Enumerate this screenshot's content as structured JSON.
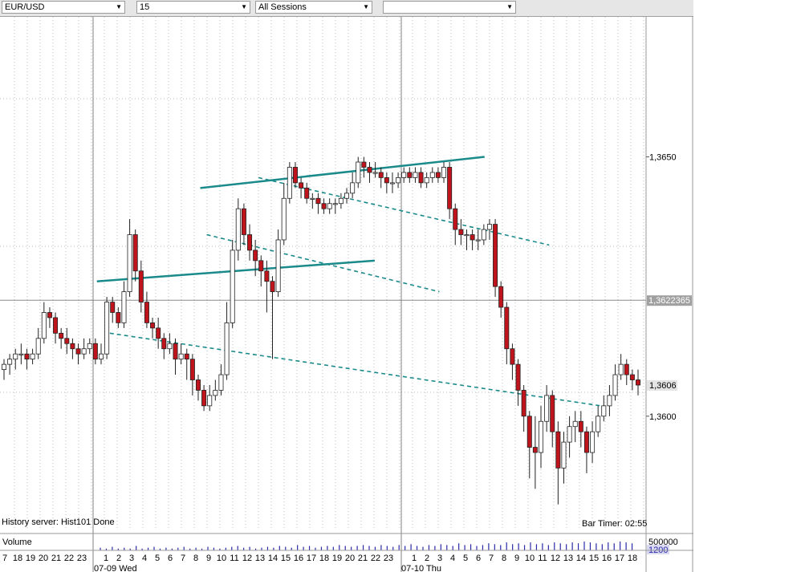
{
  "toolbar": {
    "symbol": "EUR/USD",
    "interval": "15",
    "sessions": "All Sessions",
    "extra": ""
  },
  "status": {
    "history": "History server: Hist101 Done",
    "bar_timer": "Bar Timer: 02:55"
  },
  "volume": {
    "label": "Volume",
    "scale_label": "500000",
    "value": "1200",
    "bars": [
      3,
      2,
      4,
      2,
      3,
      2,
      5,
      2,
      3,
      4,
      2,
      3,
      2,
      3,
      4,
      2,
      3,
      2,
      4,
      3,
      2,
      3,
      4,
      5,
      3,
      4,
      2,
      3,
      4,
      3,
      5,
      4,
      3,
      6,
      4,
      5,
      3,
      4,
      5,
      4,
      6,
      5,
      4,
      5,
      6,
      5,
      4,
      6,
      5,
      4,
      6,
      5,
      7,
      5,
      4,
      6,
      5,
      7,
      6,
      5,
      8,
      6,
      7,
      5,
      6,
      8,
      7,
      6,
      9,
      7,
      8,
      6,
      9,
      7,
      8,
      6,
      9,
      8,
      7,
      9,
      8,
      10,
      9,
      8,
      7,
      9,
      8,
      10,
      9,
      8
    ]
  },
  "price_axis": {
    "labels": [
      "1,3650",
      "1,3600"
    ],
    "crosshair_label": "1,3622365",
    "last_label": "1,3606"
  },
  "time_axis": {
    "hours": [
      "7",
      "18",
      "19",
      "20",
      "21",
      "22",
      "23",
      "1",
      "2",
      "3",
      "4",
      "5",
      "6",
      "7",
      "8",
      "9",
      "10",
      "11",
      "12",
      "13",
      "14",
      "15",
      "16",
      "17",
      "18",
      "19",
      "20",
      "21",
      "22",
      "23",
      "1",
      "2",
      "3",
      "4",
      "5",
      "6",
      "7",
      "8",
      "9",
      "10",
      "11",
      "12",
      "13",
      "14",
      "15",
      "16",
      "17",
      "18"
    ],
    "dates": [
      "07-09 Wed",
      "07-10 Thu"
    ]
  },
  "chart_data": {
    "type": "candlestick",
    "instrument": "EUR/USD",
    "timeframe": "15",
    "ylim": [
      1.3578,
      1.3677
    ],
    "y_ticks": [
      1.365,
      1.36
    ],
    "crosshair_price": 1.3622365,
    "last_price": 1.3606,
    "closes": [
      1.361,
      1.3611,
      1.3612,
      1.3612,
      1.3611,
      1.3612,
      1.3615,
      1.362,
      1.3619,
      1.3616,
      1.3615,
      1.3614,
      1.3613,
      1.3612,
      1.3613,
      1.3614,
      1.3611,
      1.3612,
      1.3622,
      1.362,
      1.3618,
      1.3624,
      1.3635,
      1.3628,
      1.3622,
      1.3618,
      1.3617,
      1.3615,
      1.3613,
      1.3614,
      1.3611,
      1.3612,
      1.3611,
      1.3607,
      1.3605,
      1.3602,
      1.3604,
      1.3605,
      1.3608,
      1.3618,
      1.3632,
      1.364,
      1.3635,
      1.3632,
      1.363,
      1.3628,
      1.3626,
      1.3624,
      1.3634,
      1.3642,
      1.3648,
      1.3645,
      1.3644,
      1.3642,
      1.3642,
      1.3641,
      1.364,
      1.3641,
      1.3641,
      1.3642,
      1.3643,
      1.3645,
      1.3649,
      1.3648,
      1.3647,
      1.3647,
      1.3646,
      1.3645,
      1.3645,
      1.3646,
      1.3647,
      1.3646,
      1.3647,
      1.3645,
      1.3646,
      1.3647,
      1.3646,
      1.3648,
      1.364,
      1.3636,
      1.3635,
      1.3635,
      1.3634,
      1.3634,
      1.3636,
      1.3637,
      1.3625,
      1.3621,
      1.3613,
      1.361,
      1.3605,
      1.36,
      1.3594,
      1.3593,
      1.3599,
      1.3604,
      1.3597,
      1.359,
      1.3595,
      1.3598,
      1.3599,
      1.3597,
      1.3593,
      1.3597,
      1.36,
      1.3602,
      1.3604,
      1.3608,
      1.361,
      1.3608,
      1.3607,
      1.3606
    ],
    "ohlc": [
      [
        1.3609,
        1.3611,
        1.3607,
        1.361
      ],
      [
        1.361,
        1.3612,
        1.3608,
        1.3611
      ],
      [
        1.3611,
        1.3613,
        1.3609,
        1.3612
      ],
      [
        1.3612,
        1.3614,
        1.361,
        1.3612
      ],
      [
        1.3612,
        1.3613,
        1.3609,
        1.3611
      ],
      [
        1.3611,
        1.3613,
        1.361,
        1.3612
      ],
      [
        1.3612,
        1.3617,
        1.3611,
        1.3615
      ],
      [
        1.3615,
        1.3622,
        1.3614,
        1.362
      ],
      [
        1.362,
        1.3621,
        1.3617,
        1.3619
      ],
      [
        1.3619,
        1.362,
        1.3614,
        1.3616
      ],
      [
        1.3616,
        1.3617,
        1.3613,
        1.3615
      ],
      [
        1.3615,
        1.3617,
        1.3612,
        1.3614
      ],
      [
        1.3614,
        1.3615,
        1.3611,
        1.3613
      ],
      [
        1.3613,
        1.3614,
        1.361,
        1.3612
      ],
      [
        1.3612,
        1.3615,
        1.3611,
        1.3613
      ],
      [
        1.3613,
        1.3615,
        1.3612,
        1.3614
      ],
      [
        1.3614,
        1.3615,
        1.361,
        1.3611
      ],
      [
        1.3611,
        1.3614,
        1.361,
        1.3612
      ],
      [
        1.3612,
        1.3623,
        1.3611,
        1.3622
      ],
      [
        1.3622,
        1.3623,
        1.3618,
        1.362
      ],
      [
        1.362,
        1.3621,
        1.3617,
        1.3618
      ],
      [
        1.3618,
        1.3626,
        1.3617,
        1.3624
      ],
      [
        1.3624,
        1.3638,
        1.3623,
        1.3635
      ],
      [
        1.3635,
        1.3636,
        1.3626,
        1.3628
      ],
      [
        1.3628,
        1.363,
        1.362,
        1.3622
      ],
      [
        1.3622,
        1.3624,
        1.3617,
        1.3618
      ],
      [
        1.3618,
        1.3619,
        1.3615,
        1.3617
      ],
      [
        1.3617,
        1.3619,
        1.3613,
        1.3615
      ],
      [
        1.3615,
        1.3616,
        1.3611,
        1.3613
      ],
      [
        1.3613,
        1.3616,
        1.3612,
        1.3614
      ],
      [
        1.3614,
        1.3615,
        1.3608,
        1.3611
      ],
      [
        1.3611,
        1.3614,
        1.361,
        1.3612
      ],
      [
        1.3612,
        1.3613,
        1.3607,
        1.3611
      ],
      [
        1.3611,
        1.3612,
        1.3604,
        1.3607
      ],
      [
        1.3607,
        1.3608,
        1.3603,
        1.3605
      ],
      [
        1.3605,
        1.3606,
        1.3601,
        1.3602
      ],
      [
        1.3602,
        1.3606,
        1.3601,
        1.3604
      ],
      [
        1.3604,
        1.3607,
        1.3603,
        1.3605
      ],
      [
        1.3605,
        1.361,
        1.3604,
        1.3608
      ],
      [
        1.3608,
        1.3622,
        1.3607,
        1.3618
      ],
      [
        1.3618,
        1.3634,
        1.3617,
        1.3632
      ],
      [
        1.3632,
        1.3642,
        1.363,
        1.364
      ],
      [
        1.364,
        1.3641,
        1.3633,
        1.3635
      ],
      [
        1.3635,
        1.3637,
        1.363,
        1.3632
      ],
      [
        1.3632,
        1.3634,
        1.3627,
        1.363
      ],
      [
        1.363,
        1.3631,
        1.3625,
        1.3628
      ],
      [
        1.3628,
        1.363,
        1.362,
        1.3626
      ],
      [
        1.3626,
        1.3627,
        1.3611,
        1.3624
      ],
      [
        1.3624,
        1.3636,
        1.3623,
        1.3634
      ],
      [
        1.3634,
        1.3645,
        1.3633,
        1.3642
      ],
      [
        1.3642,
        1.3649,
        1.3641,
        1.3648
      ],
      [
        1.3648,
        1.3649,
        1.3644,
        1.3645
      ],
      [
        1.3645,
        1.3646,
        1.3642,
        1.3644
      ],
      [
        1.3644,
        1.3645,
        1.3641,
        1.3642
      ],
      [
        1.3642,
        1.3643,
        1.364,
        1.3642
      ],
      [
        1.3642,
        1.3643,
        1.3639,
        1.3641
      ],
      [
        1.3641,
        1.3642,
        1.3639,
        1.364
      ],
      [
        1.364,
        1.3642,
        1.3639,
        1.3641
      ],
      [
        1.3641,
        1.3642,
        1.3639,
        1.3641
      ],
      [
        1.3641,
        1.3643,
        1.364,
        1.3642
      ],
      [
        1.3642,
        1.3644,
        1.3641,
        1.3643
      ],
      [
        1.3643,
        1.3647,
        1.3642,
        1.3645
      ],
      [
        1.3645,
        1.365,
        1.3644,
        1.3649
      ],
      [
        1.3649,
        1.365,
        1.3646,
        1.3648
      ],
      [
        1.3648,
        1.3649,
        1.3645,
        1.3647
      ],
      [
        1.3647,
        1.3649,
        1.3646,
        1.3647
      ],
      [
        1.3647,
        1.3648,
        1.3644,
        1.3646
      ],
      [
        1.3646,
        1.3647,
        1.3643,
        1.3645
      ],
      [
        1.3645,
        1.3647,
        1.3643,
        1.3645
      ],
      [
        1.3645,
        1.3647,
        1.3644,
        1.3646
      ],
      [
        1.3646,
        1.3648,
        1.3645,
        1.3647
      ],
      [
        1.3647,
        1.3648,
        1.3645,
        1.3646
      ],
      [
        1.3646,
        1.3648,
        1.3645,
        1.3647
      ],
      [
        1.3647,
        1.3648,
        1.3644,
        1.3645
      ],
      [
        1.3645,
        1.3647,
        1.3644,
        1.3646
      ],
      [
        1.3646,
        1.3648,
        1.3645,
        1.3647
      ],
      [
        1.3647,
        1.3648,
        1.3645,
        1.3646
      ],
      [
        1.3646,
        1.3649,
        1.3645,
        1.3648
      ],
      [
        1.3648,
        1.3649,
        1.3638,
        1.364
      ],
      [
        1.364,
        1.3641,
        1.3633,
        1.3636
      ],
      [
        1.3636,
        1.3638,
        1.3633,
        1.3635
      ],
      [
        1.3635,
        1.3636,
        1.3632,
        1.3635
      ],
      [
        1.3635,
        1.3636,
        1.3632,
        1.3634
      ],
      [
        1.3634,
        1.3636,
        1.3632,
        1.3634
      ],
      [
        1.3634,
        1.3637,
        1.3633,
        1.3636
      ],
      [
        1.3636,
        1.3638,
        1.3634,
        1.3637
      ],
      [
        1.3637,
        1.3638,
        1.3623,
        1.3625
      ],
      [
        1.3625,
        1.3626,
        1.3619,
        1.3621
      ],
      [
        1.3621,
        1.3622,
        1.361,
        1.3613
      ],
      [
        1.3613,
        1.3614,
        1.3607,
        1.361
      ],
      [
        1.361,
        1.3611,
        1.3602,
        1.3605
      ],
      [
        1.3605,
        1.3606,
        1.3597,
        1.36
      ],
      [
        1.36,
        1.3601,
        1.3588,
        1.3594
      ],
      [
        1.3594,
        1.36,
        1.3586,
        1.3593
      ],
      [
        1.3593,
        1.3602,
        1.359,
        1.3599
      ],
      [
        1.3599,
        1.3606,
        1.3597,
        1.3604
      ],
      [
        1.3604,
        1.3605,
        1.3594,
        1.3597
      ],
      [
        1.3597,
        1.3599,
        1.3583,
        1.359
      ],
      [
        1.359,
        1.3597,
        1.3587,
        1.3595
      ],
      [
        1.3595,
        1.36,
        1.3592,
        1.3598
      ],
      [
        1.3598,
        1.3601,
        1.3595,
        1.3599
      ],
      [
        1.3599,
        1.3601,
        1.3594,
        1.3597
      ],
      [
        1.3597,
        1.3598,
        1.3589,
        1.3593
      ],
      [
        1.3593,
        1.3599,
        1.3591,
        1.3597
      ],
      [
        1.3597,
        1.3602,
        1.3596,
        1.36
      ],
      [
        1.36,
        1.3604,
        1.3599,
        1.3602
      ],
      [
        1.3602,
        1.3606,
        1.36,
        1.3604
      ],
      [
        1.3604,
        1.361,
        1.3603,
        1.3608
      ],
      [
        1.3608,
        1.3612,
        1.3607,
        1.361
      ],
      [
        1.361,
        1.3611,
        1.3606,
        1.3608
      ],
      [
        1.3608,
        1.3609,
        1.3605,
        1.3607
      ],
      [
        1.3607,
        1.3609,
        1.3604,
        1.3606
      ]
    ],
    "trendlines": [
      {
        "style": "solid",
        "from": [
          0.15,
          1.3626
        ],
        "to": [
          0.58,
          1.363
        ]
      },
      {
        "style": "solid",
        "from": [
          0.31,
          1.3644
        ],
        "to": [
          0.75,
          1.365
        ]
      },
      {
        "style": "dashed",
        "from": [
          0.4,
          1.3646
        ],
        "to": [
          0.85,
          1.3633
        ]
      },
      {
        "style": "dashed",
        "from": [
          0.32,
          1.3635
        ],
        "to": [
          0.68,
          1.3624
        ]
      },
      {
        "style": "dashed",
        "from": [
          0.17,
          1.3616
        ],
        "to": [
          0.93,
          1.3602
        ]
      }
    ]
  }
}
